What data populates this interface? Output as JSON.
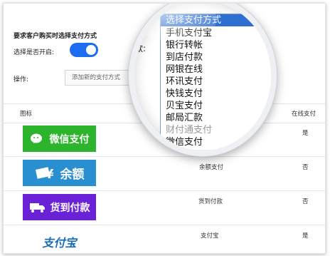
{
  "settings": {
    "title": "要求客户购买时选择支付方式",
    "toggle_label": "选择是否开启:",
    "toggle_on": true,
    "op_label": "操作:",
    "add_button": "添加新的支付方式"
  },
  "table": {
    "col_icon": "图标",
    "col_online": "在线支付",
    "rows": [
      {
        "logo": "微信支付",
        "name": "",
        "online": "是"
      },
      {
        "logo": "余额",
        "name": "余额支付",
        "online": "否"
      },
      {
        "logo": "货到付款",
        "name": "货到付款",
        "online": "否"
      },
      {
        "logo": "支付宝",
        "name": "支付宝",
        "online": "是"
      }
    ]
  },
  "dropdown": {
    "label": "款:",
    "selected": "选择支付方式",
    "options": [
      "手机支付宝",
      "银行转帐",
      "到店付款",
      "网银在线",
      "环讯支付",
      "快钱支付",
      "贝宝支付",
      "邮局汇款",
      "财付通支付",
      "微信支付"
    ]
  },
  "colors": {
    "accent": "#1e6cf0",
    "wechat": "#2cb52c",
    "balance": "#2a8fd0",
    "cod": "#6b21d8"
  }
}
